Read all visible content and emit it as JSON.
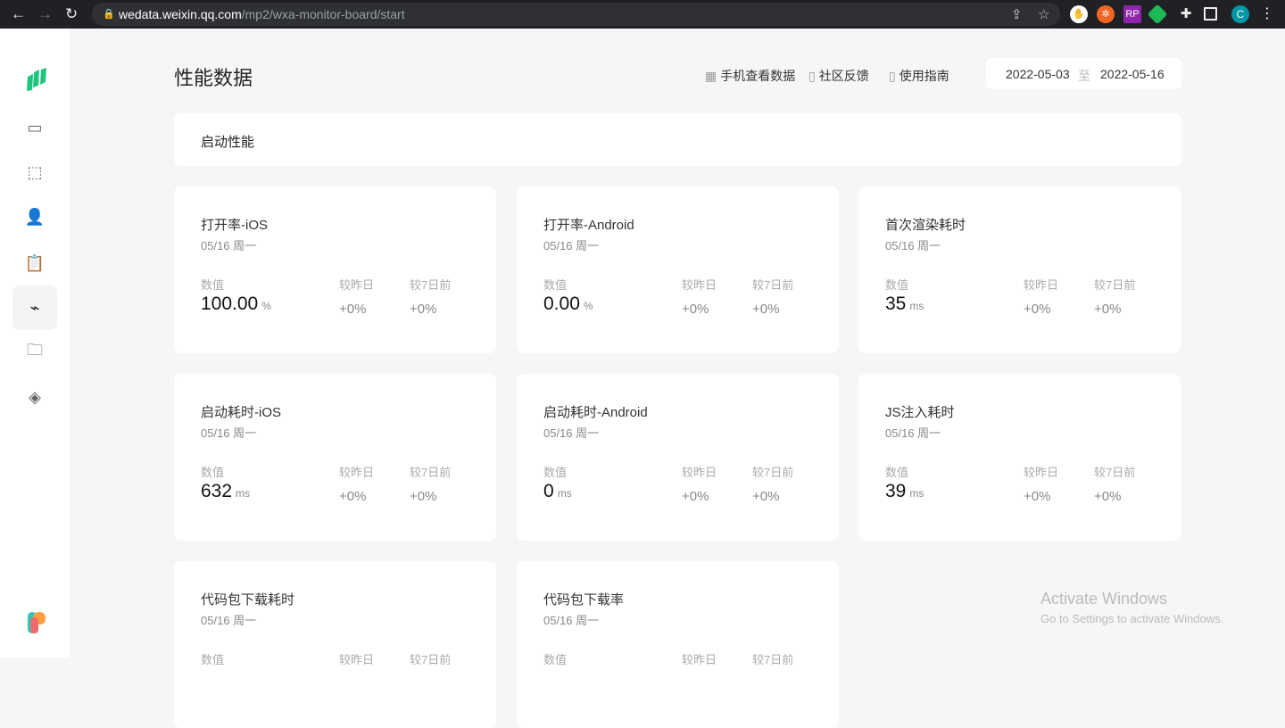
{
  "browser": {
    "url_host": "wedata.weixin.qq.com",
    "url_path": "/mp2/wxa-monitor-board/start",
    "profile_initial": "C"
  },
  "header": {
    "title": "性能数据",
    "links": [
      "手机查看数据",
      "社区反馈",
      "使用指南"
    ],
    "date_start": "2022-05-03",
    "date_sep": "至",
    "date_end": "2022-05-16"
  },
  "section": {
    "title": "启动性能"
  },
  "labels": {
    "value": "数值",
    "vs_yesterday": "较昨日",
    "vs_7days": "较7日前"
  },
  "cards": [
    {
      "title": "打开率-iOS",
      "date": "05/16 周一",
      "value": "100.00",
      "unit": "%",
      "d1": "+0%",
      "d7": "+0%"
    },
    {
      "title": "打开率-Android",
      "date": "05/16 周一",
      "value": "0.00",
      "unit": "%",
      "d1": "+0%",
      "d7": "+0%"
    },
    {
      "title": "首次渲染耗时",
      "date": "05/16 周一",
      "value": "35",
      "unit": "ms",
      "d1": "+0%",
      "d7": "+0%"
    },
    {
      "title": "启动耗时-iOS",
      "date": "05/16 周一",
      "value": "632",
      "unit": "ms",
      "d1": "+0%",
      "d7": "+0%"
    },
    {
      "title": "启动耗时-Android",
      "date": "05/16 周一",
      "value": "0",
      "unit": "ms",
      "d1": "+0%",
      "d7": "+0%"
    },
    {
      "title": "JS注入耗时",
      "date": "05/16 周一",
      "value": "39",
      "unit": "ms",
      "d1": "+0%",
      "d7": "+0%"
    },
    {
      "title": "代码包下载耗时",
      "date": "05/16 周一",
      "value": "",
      "unit": "",
      "d1": "",
      "d7": ""
    },
    {
      "title": "代码包下载率",
      "date": "05/16 周一",
      "value": "",
      "unit": "",
      "d1": "",
      "d7": ""
    }
  ],
  "watermark": {
    "line1": "Activate Windows",
    "line2": "Go to Settings to activate Windows."
  }
}
